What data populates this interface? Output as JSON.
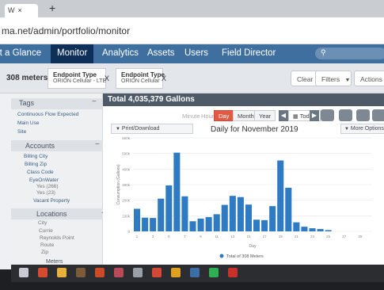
{
  "browser": {
    "tab_label": "W",
    "tab_close": "×",
    "new_tab": "+",
    "url": "ma.net/admin/portfolio/monitor"
  },
  "nav": {
    "items": [
      "At a Glance",
      "Monitor",
      "Analytics",
      "Assets",
      "Users",
      "Field Director"
    ],
    "active": "Monitor"
  },
  "filterbar": {
    "meters_count": "308 meters",
    "chips": [
      {
        "title": "Endpoint Type",
        "value": "ORION Cellular - LTE"
      },
      {
        "title": "Endpoint Type",
        "value": "ORION Cellular"
      }
    ],
    "chip_close": "X",
    "clear_label": "Clear",
    "filters_label": "Filters",
    "actions_label": "Actions"
  },
  "sidebar": {
    "tags_title": "Tags",
    "tags": [
      "Continuous Flow Expected",
      "Main Use",
      "Site"
    ],
    "accounts_title": "Accounts",
    "accounts": [
      "Billing City",
      "Billing Zip",
      "Class Code",
      "EyeOnWater",
      "Yes (266)",
      "Yes (23)",
      "Vacant Property"
    ],
    "locations_title": "Locations",
    "locations": [
      "City",
      "Currie",
      "Reynolds Point",
      "Route",
      "Zip"
    ],
    "meters_title": "Meters",
    "collapse": "−"
  },
  "main": {
    "header": "Total 4,035,379 Gallons",
    "period_controls": [
      "Minute",
      "Hour",
      "Day",
      "Month",
      "Year"
    ],
    "active_period": "Day",
    "today_label": "Today",
    "print_label": "Print/Download",
    "more_options_label": "More Options",
    "chart_title": "Daily for November 2019"
  },
  "chart_data": {
    "type": "bar",
    "title": "Daily for November 2019",
    "xlabel": "Day",
    "ylabel": "Consumption (Gallons)",
    "ylim": [
      0,
      600000
    ],
    "yticks": [
      "0",
      "100k",
      "200k",
      "300k",
      "400k",
      "500k",
      "600k"
    ],
    "categories": [
      "1",
      "2",
      "3",
      "4",
      "5",
      "6",
      "7",
      "8",
      "9",
      "10",
      "11",
      "12",
      "13",
      "14",
      "15",
      "16",
      "17",
      "18",
      "19",
      "20",
      "21",
      "22",
      "23",
      "24",
      "25",
      "26",
      "27",
      "28",
      "29",
      "30"
    ],
    "series": [
      {
        "name": "Total of 308 Meters",
        "color": "#2e7bc4",
        "values": [
          145000,
          88000,
          86000,
          210000,
          295000,
          505000,
          225000,
          65000,
          82000,
          92000,
          110000,
          170000,
          228000,
          220000,
          172000,
          75000,
          72000,
          162000,
          455000,
          280000,
          58000,
          30000,
          20000,
          15000,
          8000,
          0,
          0,
          0,
          0,
          0
        ]
      }
    ]
  }
}
